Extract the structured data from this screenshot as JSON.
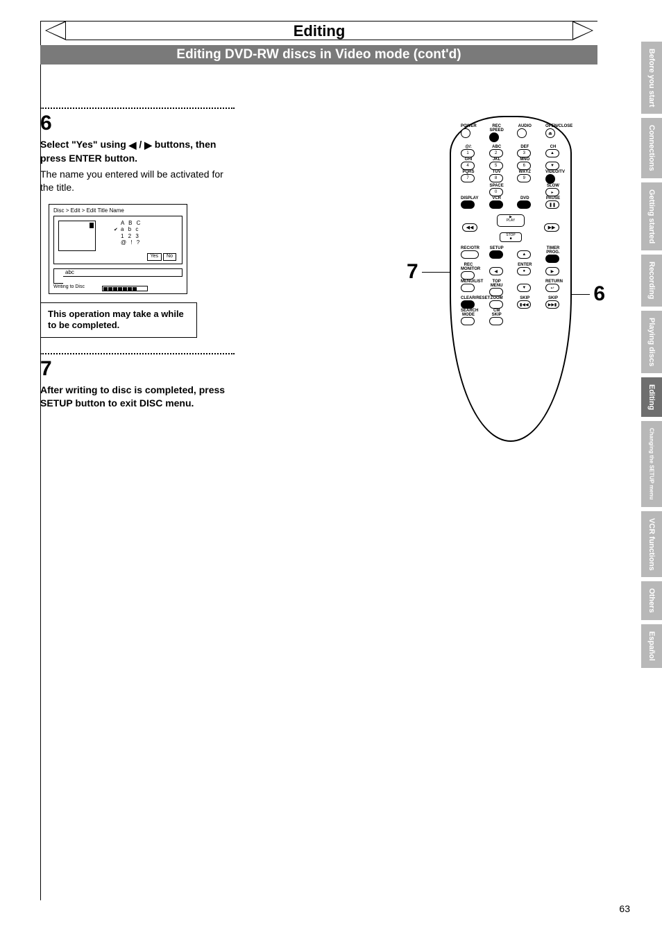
{
  "header": {
    "title": "Editing",
    "section": "Editing DVD-RW discs in Video mode (cont'd)"
  },
  "step6": {
    "num": "6",
    "bold_pre": "Select \"Yes\" using ",
    "bold_mid": " / ",
    "bold_post": " buttons, then press ENTER button.",
    "body": "The name you entered will be activated for the title."
  },
  "osd": {
    "crumb": "Disc > Edit > Edit Title Name",
    "modes": [
      "A B C",
      "a b c",
      "1 2 3",
      "@ ! ?"
    ],
    "selected_mode_index": 1,
    "yes": "Yes",
    "no": "No",
    "field_value": "abc",
    "writing": "Writing to Disc"
  },
  "note": "This operation may take a while to be completed.",
  "step7": {
    "num": "7",
    "bold": "After writing to disc is completed, press SETUP button to exit DISC menu."
  },
  "remote": {
    "callout_left": "7",
    "callout_right": "6",
    "row1_labels": [
      "POWER",
      "REC SPEED",
      "AUDIO",
      "OPEN/CLOSE"
    ],
    "row2_labels": [
      "@/:",
      "ABC",
      "DEF",
      ""
    ],
    "row2_nums": [
      "1",
      "2",
      "3",
      ""
    ],
    "row2_side": [
      "",
      "",
      "",
      "CH"
    ],
    "row3_labels": [
      "GHI",
      "JKL",
      "MNO",
      ""
    ],
    "row3_nums": [
      "4",
      "5",
      "6",
      ""
    ],
    "row4_labels": [
      "PQRS",
      "TUV",
      "WXYZ",
      "VIDEO/TV"
    ],
    "row4_nums": [
      "7",
      "8",
      "9",
      ""
    ],
    "row5_label_space": "SPACE",
    "row5_num": "0",
    "row5_label_slow": "SLOW",
    "row6_labels": [
      "DISPLAY",
      "VCR",
      "DVD",
      "PAUSE"
    ],
    "nav_play": "PLAY",
    "nav_stop": "STOP",
    "row7_labels": [
      "REC/OTR",
      "SETUP",
      "",
      "TIMER PROG."
    ],
    "row8_labels": [
      "REC MONITOR",
      "",
      "ENTER",
      ""
    ],
    "row9_labels": [
      "MENU/LIST",
      "TOP MENU",
      "",
      "RETURN"
    ],
    "row10_labels": [
      "CLEAR/RESET",
      "ZOOM",
      "SKIP",
      "SKIP"
    ],
    "row11_labels": [
      "SEARCH MODE",
      "CM SKIP",
      "",
      ""
    ]
  },
  "tabs": [
    {
      "label": "Before you start",
      "active": false
    },
    {
      "label": "Connections",
      "active": false
    },
    {
      "label": "Getting started",
      "active": false
    },
    {
      "label": "Recording",
      "active": false
    },
    {
      "label": "Playing discs",
      "active": false
    },
    {
      "label": "Editing",
      "active": true
    },
    {
      "label": "Changing the SETUP menu",
      "active": false,
      "small": true
    },
    {
      "label": "VCR functions",
      "active": false
    },
    {
      "label": "Others",
      "active": false
    },
    {
      "label": "Español",
      "active": false
    }
  ],
  "page_number": "63"
}
